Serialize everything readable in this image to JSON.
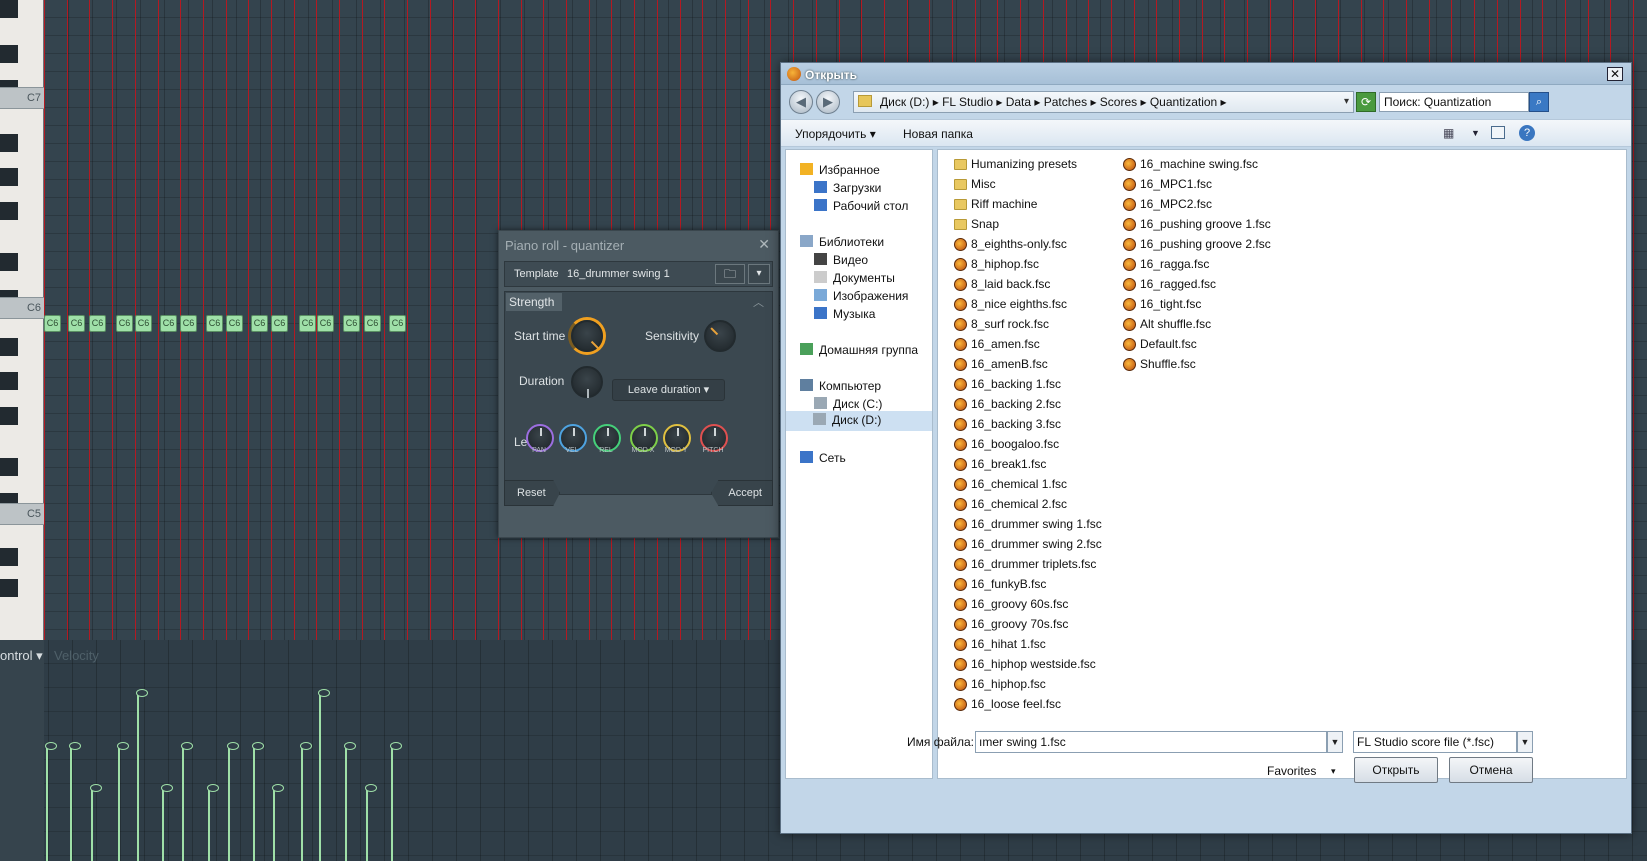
{
  "piano_roll": {
    "octave_labels": [
      "C7",
      "C6",
      "C5"
    ],
    "note_label": "C6",
    "note_count": 16,
    "control_label": "ontrol",
    "velocity_label": "Velocity",
    "velocity_levels": [
      0.55,
      0.55,
      0.35,
      0.55,
      0.8,
      0.35,
      0.55,
      0.35,
      0.55,
      0.55,
      0.35,
      0.55,
      0.8,
      0.55,
      0.35,
      0.55
    ]
  },
  "quantizer": {
    "title": "Piano roll - quantizer",
    "template_label": "Template",
    "template_value": "16_drummer swing 1",
    "strength_tab": "Strength",
    "start_time_label": "Start time",
    "sensitivity_label": "Sensitivity",
    "duration_label": "Duration",
    "duration_mode": "Leave duration",
    "levels_label": "Levels",
    "level_knobs": [
      {
        "label": "PAN",
        "color": "#9c6ee0"
      },
      {
        "label": "VEL",
        "color": "#4ea3e0"
      },
      {
        "label": "REL",
        "color": "#45d07a"
      },
      {
        "label": "MOD X",
        "color": "#7ed048"
      },
      {
        "label": "MOD Y",
        "color": "#e0c040"
      },
      {
        "label": "PITCH",
        "color": "#e05050"
      }
    ],
    "reset_label": "Reset",
    "accept_label": "Accept"
  },
  "open_dialog": {
    "title": "Открыть",
    "address_path": "Диск (D:) ▸ FL Studio ▸ Data ▸ Patches ▸ Scores ▸ Quantization ▸",
    "search_text": "Поиск: Quantization",
    "organize_label": "Упорядочить",
    "new_folder_label": "Новая папка",
    "nav_items": [
      {
        "label": "Избранное",
        "icon": "star-icon"
      },
      {
        "label": "Загрузки",
        "icon": "downloads-icon"
      },
      {
        "label": "Рабочий стол",
        "icon": "desktop-icon"
      },
      {
        "label": "Библиотеки",
        "icon": "libraries-icon"
      },
      {
        "label": "Видео",
        "icon": "video-icon"
      },
      {
        "label": "Документы",
        "icon": "documents-icon"
      },
      {
        "label": "Изображения",
        "icon": "pictures-icon"
      },
      {
        "label": "Музыка",
        "icon": "music-icon"
      },
      {
        "label": "Домашняя группа",
        "icon": "homegroup-icon"
      },
      {
        "label": "Компьютер",
        "icon": "computer-icon"
      },
      {
        "label": "Диск (C:)",
        "icon": "drive-icon"
      },
      {
        "label": "Диск (D:)",
        "icon": "drive-icon",
        "selected": true
      },
      {
        "label": "Сеть",
        "icon": "network-icon"
      }
    ],
    "files_col1": [
      {
        "name": "Humanizing presets",
        "type": "folder"
      },
      {
        "name": "Misc",
        "type": "folder"
      },
      {
        "name": "Riff machine",
        "type": "folder"
      },
      {
        "name": "Snap",
        "type": "folder"
      },
      {
        "name": "8_eighths-only.fsc",
        "type": "fsc"
      },
      {
        "name": "8_hiphop.fsc",
        "type": "fsc"
      },
      {
        "name": "8_laid back.fsc",
        "type": "fsc"
      },
      {
        "name": "8_nice eighths.fsc",
        "type": "fsc"
      },
      {
        "name": "8_surf rock.fsc",
        "type": "fsc"
      },
      {
        "name": "16_amen.fsc",
        "type": "fsc"
      },
      {
        "name": "16_amenB.fsc",
        "type": "fsc"
      },
      {
        "name": "16_backing 1.fsc",
        "type": "fsc"
      },
      {
        "name": "16_backing 2.fsc",
        "type": "fsc"
      },
      {
        "name": "16_backing 3.fsc",
        "type": "fsc"
      },
      {
        "name": "16_boogaloo.fsc",
        "type": "fsc"
      },
      {
        "name": "16_break1.fsc",
        "type": "fsc"
      },
      {
        "name": "16_chemical 1.fsc",
        "type": "fsc"
      },
      {
        "name": "16_chemical 2.fsc",
        "type": "fsc"
      },
      {
        "name": "16_drummer swing 1.fsc",
        "type": "fsc"
      },
      {
        "name": "16_drummer swing 2.fsc",
        "type": "fsc"
      },
      {
        "name": "16_drummer triplets.fsc",
        "type": "fsc"
      },
      {
        "name": "16_funkyB.fsc",
        "type": "fsc"
      },
      {
        "name": "16_groovy 60s.fsc",
        "type": "fsc"
      },
      {
        "name": "16_groovy 70s.fsc",
        "type": "fsc"
      },
      {
        "name": "16_hihat 1.fsc",
        "type": "fsc"
      },
      {
        "name": "16_hiphop westside.fsc",
        "type": "fsc"
      },
      {
        "name": "16_hiphop.fsc",
        "type": "fsc"
      },
      {
        "name": "16_loose feel.fsc",
        "type": "fsc"
      }
    ],
    "files_col2": [
      {
        "name": "16_machine swing.fsc",
        "type": "fsc"
      },
      {
        "name": "16_MPC1.fsc",
        "type": "fsc"
      },
      {
        "name": "16_MPC2.fsc",
        "type": "fsc"
      },
      {
        "name": "16_pushing groove 1.fsc",
        "type": "fsc"
      },
      {
        "name": "16_pushing groove 2.fsc",
        "type": "fsc"
      },
      {
        "name": "16_ragga.fsc",
        "type": "fsc"
      },
      {
        "name": "16_ragged.fsc",
        "type": "fsc"
      },
      {
        "name": "16_tight.fsc",
        "type": "fsc"
      },
      {
        "name": "Alt shuffle.fsc",
        "type": "fsc"
      },
      {
        "name": "Default.fsc",
        "type": "fsc"
      },
      {
        "name": "Shuffle.fsc",
        "type": "fsc"
      }
    ],
    "filename_label": "Имя файла:",
    "filename_value": "ımer swing 1.fsc",
    "filetype_value": "FL Studio score file (*.fsc)",
    "favorites_label": "Favorites",
    "open_button": "Открыть",
    "cancel_button": "Отмена"
  }
}
